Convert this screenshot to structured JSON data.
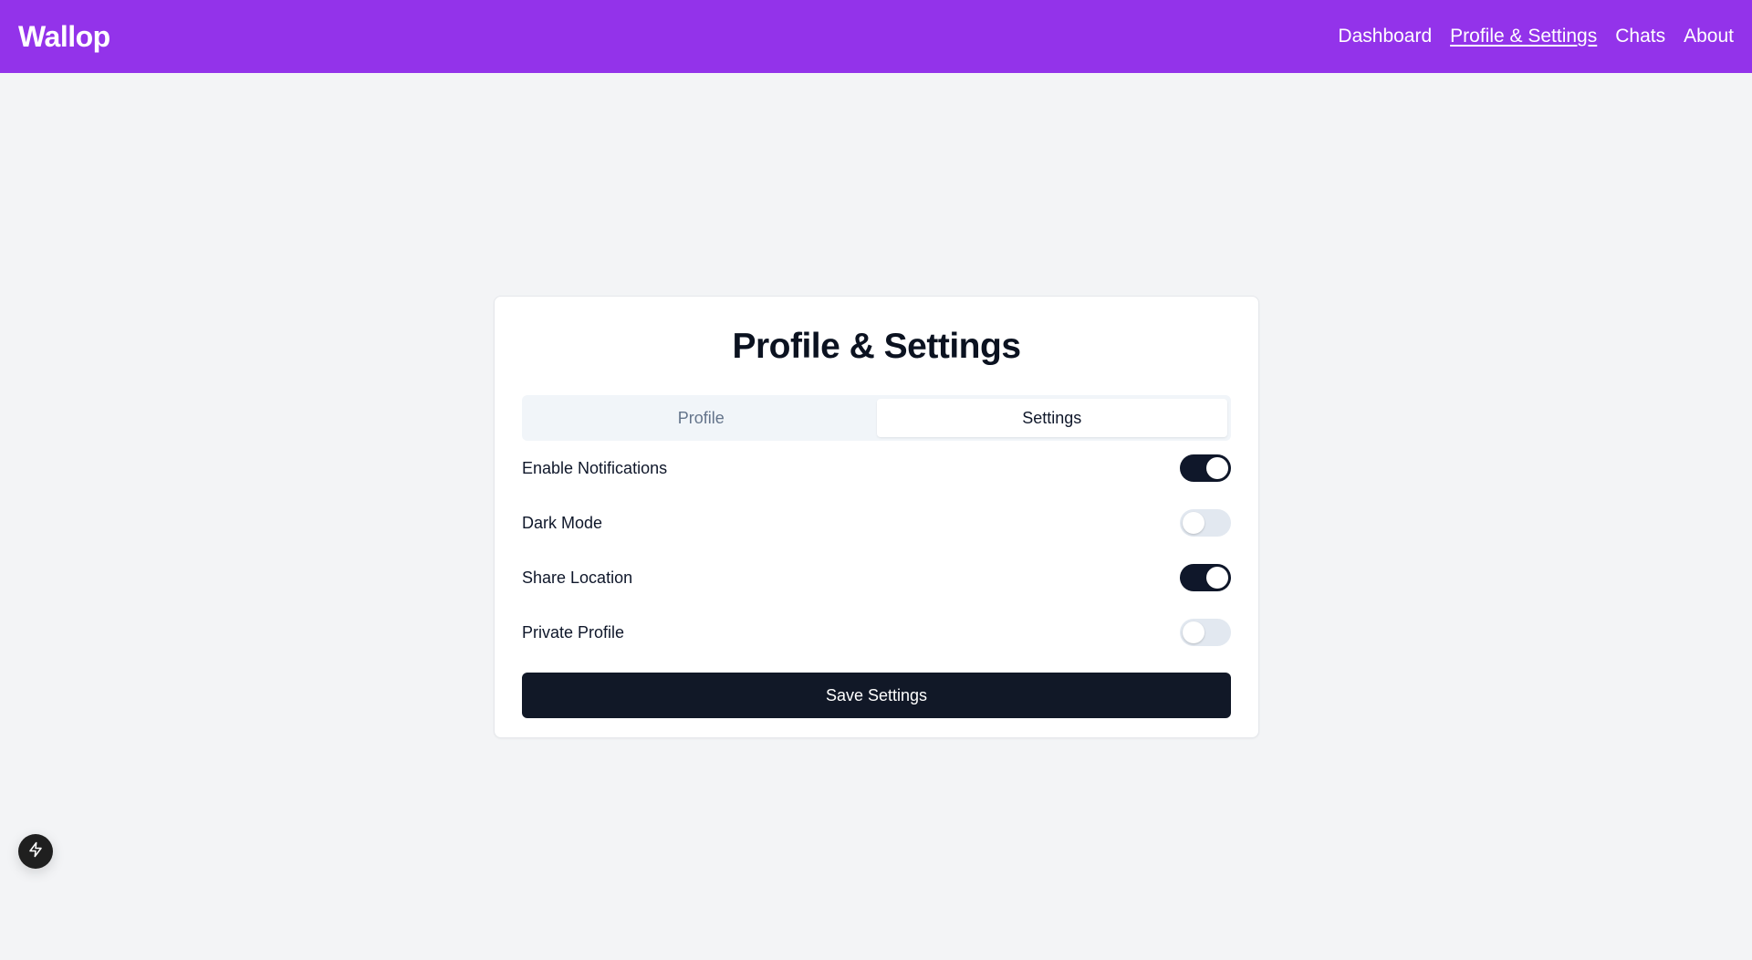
{
  "header": {
    "brand": "Wallop",
    "nav": [
      {
        "label": "Dashboard",
        "active": false
      },
      {
        "label": "Profile & Settings",
        "active": true
      },
      {
        "label": "Chats",
        "active": false
      },
      {
        "label": "About",
        "active": false
      }
    ]
  },
  "page": {
    "title": "Profile & Settings",
    "tabs": [
      {
        "label": "Profile",
        "active": false
      },
      {
        "label": "Settings",
        "active": true
      }
    ],
    "settings": [
      {
        "label": "Enable Notifications",
        "enabled": true
      },
      {
        "label": "Dark Mode",
        "enabled": false
      },
      {
        "label": "Share Location",
        "enabled": true
      },
      {
        "label": "Private Profile",
        "enabled": false
      }
    ],
    "save_label": "Save Settings"
  },
  "floating_button": {
    "icon": "lightning-bolt-icon"
  },
  "colors": {
    "header_bg": "#9333ea",
    "page_bg": "#f3f4f6",
    "toggle_on": "#0f172a",
    "toggle_off": "#e2e8f0",
    "button_bg": "#111827"
  }
}
